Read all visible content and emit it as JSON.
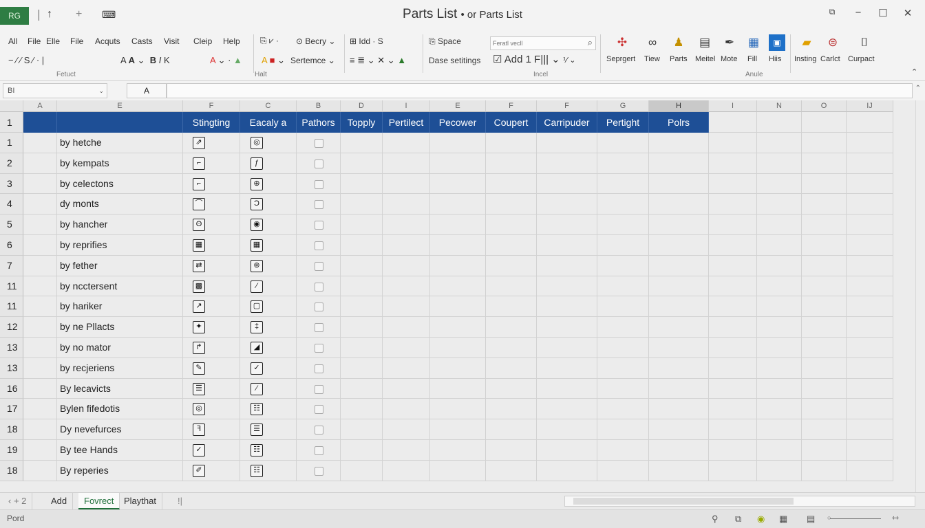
{
  "titlebar": {
    "badge": "RG",
    "title": "Parts List",
    "title_suffix": "• or Parts List",
    "minimize": "−",
    "maximize": "☐",
    "close": "✕",
    "restore_icon": "⧉"
  },
  "ribbon": {
    "tabs_row1": [
      "All",
      "File",
      "Elle",
      "File",
      "Acquts",
      "Casts",
      "Visit",
      "Cleip",
      "Help"
    ],
    "font_box": "Becry",
    "indent": "Idd · S",
    "space": "Space",
    "date_settings": "Dase setitings",
    "sentence": "Sertemce",
    "search_placeholder": "Feratl vecll",
    "add_fill": "Add 1 F|||",
    "group_labels": {
      "format": "Fetuct",
      "half": "Halt",
      "label": "Incel",
      "anule": "Anule"
    },
    "big_buttons": [
      {
        "label": "Seprgert",
        "icon": "people-colors-icon"
      },
      {
        "label": "Tiew",
        "icon": "glasses-icon"
      },
      {
        "label": "Parts",
        "icon": "person-icon"
      },
      {
        "label": "Meitel",
        "icon": "document-icon"
      },
      {
        "label": "Mote",
        "icon": "pen-icon"
      },
      {
        "label": "Fill",
        "icon": "grid-icon"
      },
      {
        "label": "Hiis",
        "icon": "window-icon"
      },
      {
        "label": "Insting",
        "icon": "folder-icon"
      },
      {
        "label": "Carlct",
        "icon": "stamp-icon"
      },
      {
        "label": "Curpact",
        "icon": "mouse-icon"
      }
    ]
  },
  "formula": {
    "namebox": "BI",
    "fx_label": "A"
  },
  "columns": [
    "A",
    "E",
    "F",
    "C",
    "B",
    "D",
    "I",
    "E",
    "F",
    "F",
    "G",
    "H",
    "I",
    "N",
    "O",
    "IJ"
  ],
  "header_row": {
    "row_number": "1",
    "cells": [
      "",
      "",
      "Stingting",
      "Eacaly a",
      "Pathors",
      "Topply",
      "Pertilect",
      "Pecower",
      "Coupert",
      "Carripuder",
      "Pertight",
      "Polrs"
    ]
  },
  "rows": [
    {
      "num": "1",
      "name": "by hetche",
      "icon_f": "⇗",
      "icon_c": "◎"
    },
    {
      "num": "2",
      "name": "by kempats",
      "icon_f": "⌐",
      "icon_c": "ƒ"
    },
    {
      "num": "3",
      "name": "by celectons",
      "icon_f": "⌐",
      "icon_c": "⊕"
    },
    {
      "num": "4",
      "name": "dy monts",
      "icon_f": "⌒",
      "icon_c": "Ɔ"
    },
    {
      "num": "5",
      "name": "by hancher",
      "icon_f": "ʘ",
      "icon_c": "◉"
    },
    {
      "num": "6",
      "name": "by reprifies",
      "icon_f": "▦",
      "icon_c": "▦"
    },
    {
      "num": "7",
      "name": "by fether",
      "icon_f": "⇄",
      "icon_c": "⊛"
    },
    {
      "num": "11",
      "name": "by ncctersent",
      "icon_f": "▩",
      "icon_c": "⁄"
    },
    {
      "num": "11",
      "name": "by hariker",
      "icon_f": "↗",
      "icon_c": "▢"
    },
    {
      "num": "12",
      "name": "by ne Pllacts",
      "icon_f": "✦",
      "icon_c": "‡"
    },
    {
      "num": "13",
      "name": "by no mator",
      "icon_f": "↱",
      "icon_c": "◢"
    },
    {
      "num": "13",
      "name": "by recjeriens",
      "icon_f": "✎",
      "icon_c": "✓"
    },
    {
      "num": "16",
      "name": "By lecavicts",
      "icon_f": "☰",
      "icon_c": "⁄"
    },
    {
      "num": "17",
      "name": "Bylen fifedotis",
      "icon_f": "◎",
      "icon_c": "☷"
    },
    {
      "num": "18",
      "name": "Dy nevefurces",
      "icon_f": "ꟻ",
      "icon_c": "☰"
    },
    {
      "num": "19",
      "name": "By tee Hands",
      "icon_f": "✓",
      "icon_c": "☷"
    },
    {
      "num": "18",
      "name": "By reperies",
      "icon_f": "✐",
      "icon_c": "☷"
    }
  ],
  "sheet_tabs": {
    "nav": "‹  +  2",
    "tabs": [
      "Add",
      "Fovrect",
      "Playthat"
    ],
    "extra": "!|",
    "active_index": 1
  },
  "status": {
    "left": "Pord"
  }
}
